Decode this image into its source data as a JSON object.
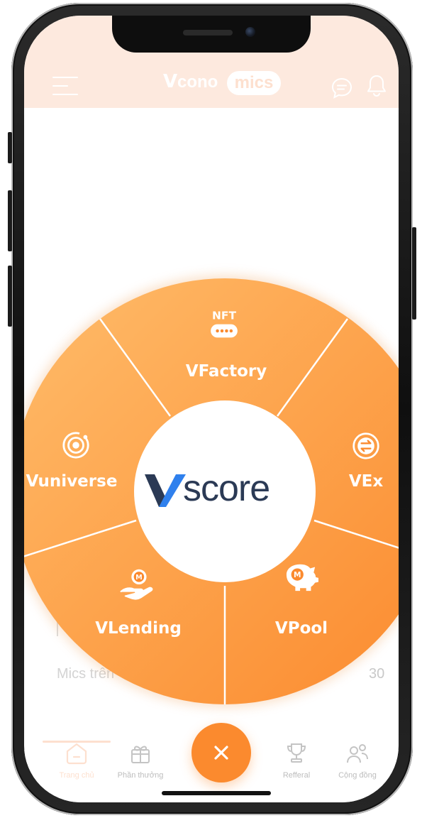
{
  "app": {
    "logo_v": "V",
    "logo_text_1": "cono",
    "logo_text_2": "mics"
  },
  "background_rows": [
    {
      "label": "Mics trên",
      "value": "30"
    }
  ],
  "radial_menu": {
    "center_logo": "score",
    "center_logo_v": "V",
    "items": [
      {
        "label": "VFactory",
        "icon": "nft-icon",
        "icon_text": "NFT"
      },
      {
        "label": "VEx",
        "icon": "exchange-icon"
      },
      {
        "label": "VPool",
        "icon": "piggy-bank-icon",
        "icon_text": "M"
      },
      {
        "label": "VLending",
        "icon": "hand-coin-icon",
        "icon_text": "M"
      },
      {
        "label": "Vuniverse",
        "icon": "orbit-icon"
      }
    ]
  },
  "bottom_nav": {
    "items": [
      {
        "label": "Trang chủ",
        "icon": "home-icon",
        "active": true
      },
      {
        "label": "Phần thưởng",
        "icon": "gift-icon"
      },
      {
        "label": "Refferal",
        "icon": "trophy-icon"
      },
      {
        "label": "Cộng đồng",
        "icon": "community-icon"
      }
    ],
    "fab_icon": "close-icon"
  },
  "colors": {
    "accent": "#FB8A2E",
    "accent_light": "#FFB05E",
    "header_bg": "#FDE9DE",
    "nav_inactive": "#BDBDBD",
    "nav_active": "#FDE0CF",
    "logo_dark": "#2B3A55",
    "logo_blue": "#2F80ED"
  }
}
